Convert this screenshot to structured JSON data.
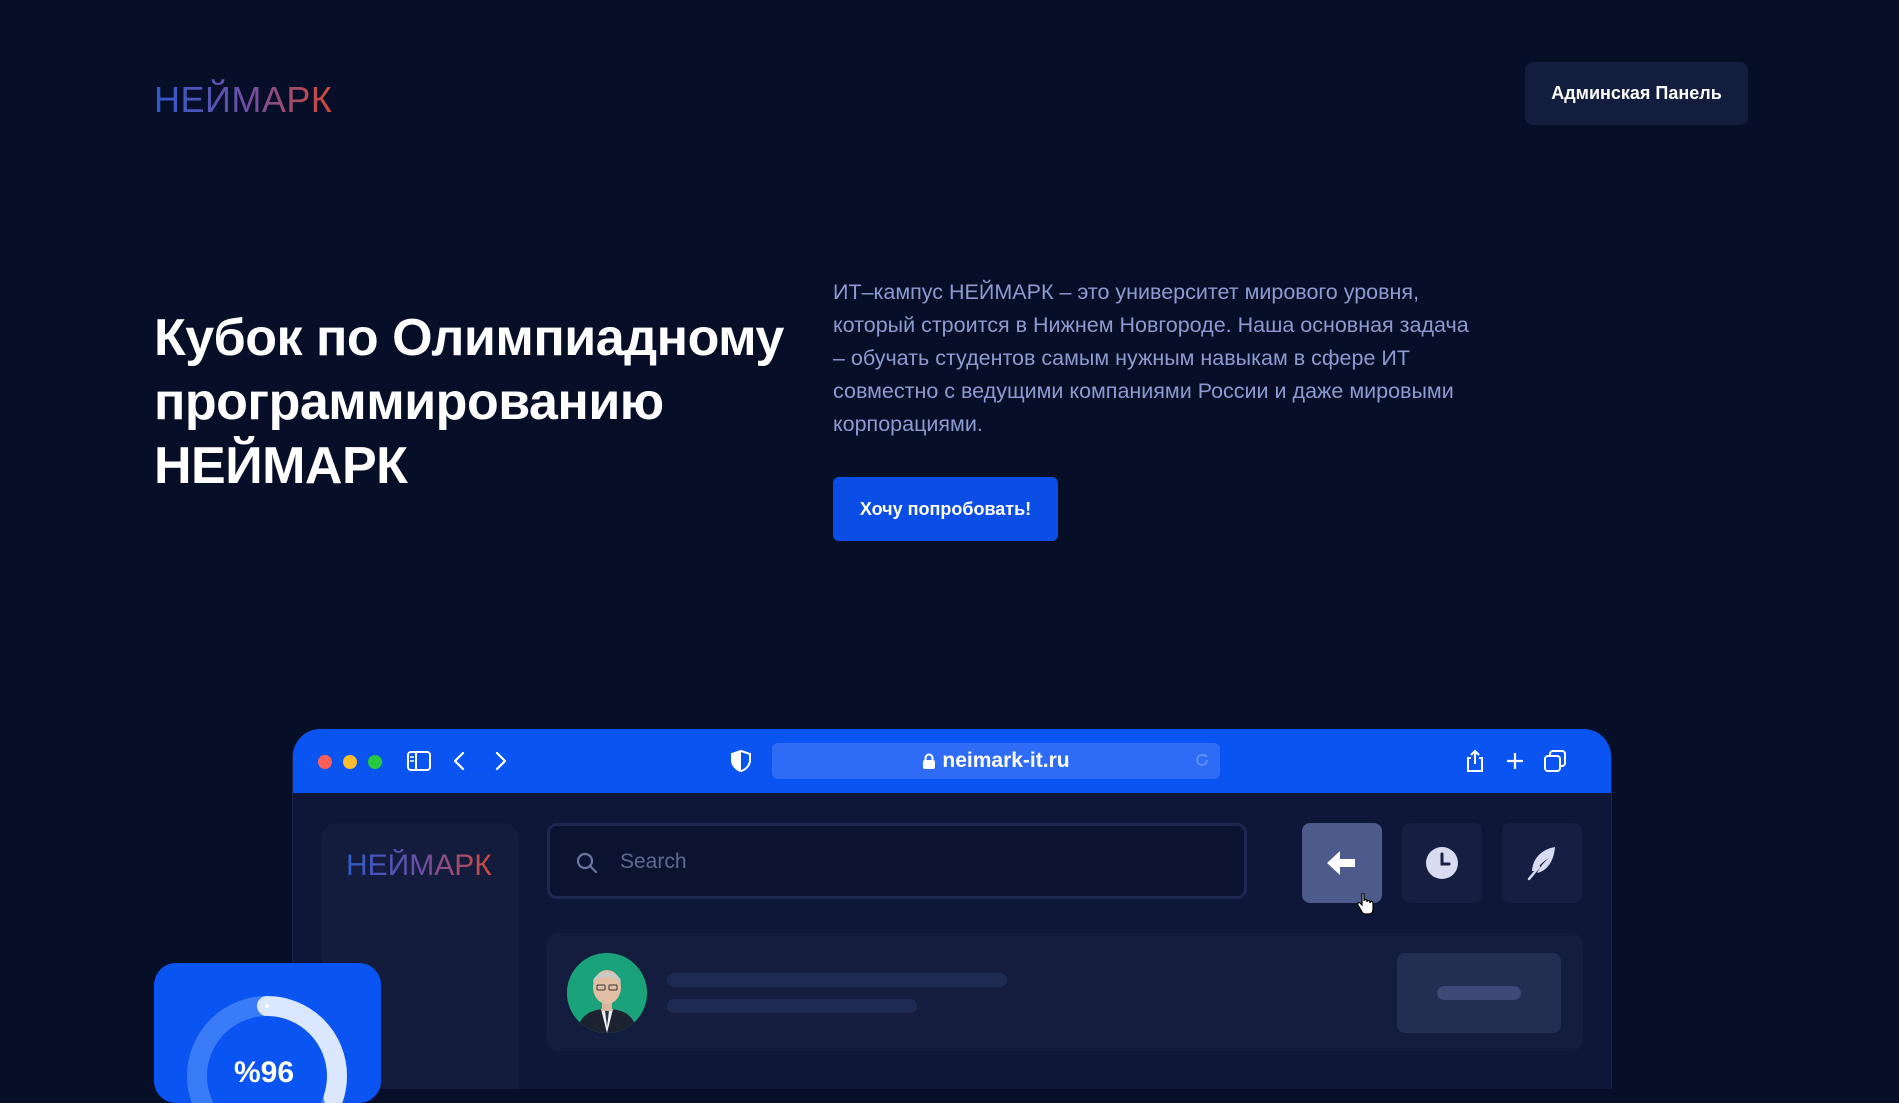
{
  "header": {
    "logo": "НЕЙМАРК",
    "admin_button": "Админская Панель"
  },
  "hero": {
    "title": "Кубок по Олимпиадному программированию НЕЙМАРК",
    "description": "ИТ–кампус НЕЙМАРК – это университет мирового уровня, который строится в Нижнем Новгороде. Наша основная задача – обучать студентов самым нужным навыкам в сфере ИТ совместно с ведущими компаниями России и даже мировыми корпорациями.",
    "cta": "Хочу попробовать!"
  },
  "mockup": {
    "url": "neimark-it.ru",
    "logo": "НЕЙМАРК",
    "search_placeholder": "Search",
    "icons": [
      "sidebar-toggle-icon",
      "back-icon",
      "forward-icon",
      "shield-icon",
      "lock-icon",
      "reload-icon",
      "share-icon",
      "plus-icon",
      "tabs-icon",
      "search-icon",
      "arrow-left-icon",
      "clock-icon",
      "feather-icon",
      "cursor-hand-icon"
    ]
  },
  "stat_widget": {
    "value": "%96",
    "progress": 0.96
  },
  "colors": {
    "background": "#070e27",
    "accent": "#0b4ee6",
    "browser_bar": "#0a54f2",
    "active_button": "#4c5a8c"
  }
}
